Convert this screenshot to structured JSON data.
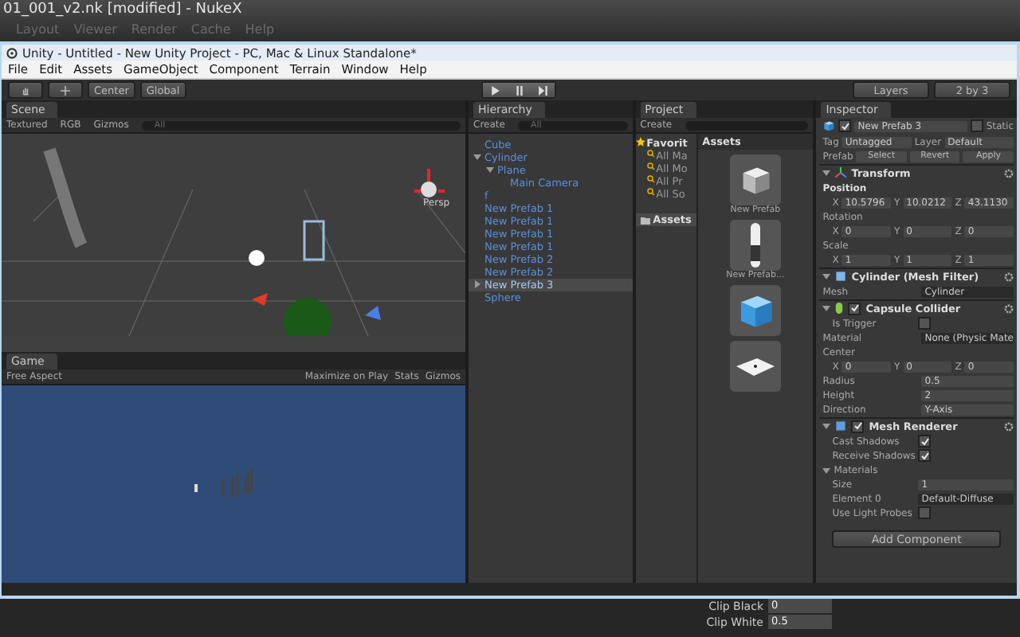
{
  "nuke": {
    "title": "01_001_v2.nk [modified] - NukeX",
    "menu": [
      "Layout",
      "Viewer",
      "Render",
      "Cache",
      "Help"
    ],
    "knobs": [
      {
        "label": "Clip Black",
        "value": "0"
      },
      {
        "label": "Clip White",
        "value": "0.5"
      }
    ]
  },
  "window": {
    "title": "Unity - Untitled - New Unity Project - PC, Mac & Linux Standalone*"
  },
  "menu": [
    "File",
    "Edit",
    "Assets",
    "GameObject",
    "Component",
    "Terrain",
    "Window",
    "Help"
  ],
  "toolbar": {
    "pivot": "Center",
    "space": "Global",
    "layers": "Layers",
    "layout": "2 by 3"
  },
  "scene": {
    "tab": "Scene",
    "render_mode": "Textured",
    "color_mode": "RGB",
    "gizmos": "Gizmos",
    "search_placeholder": "All",
    "view_label": "Persp"
  },
  "game": {
    "tab": "Game",
    "aspect": "Free Aspect",
    "buttons": [
      "Maximize on Play",
      "Stats",
      "Gizmos"
    ]
  },
  "hierarchy": {
    "tab": "Hierarchy",
    "create": "Create",
    "search_placeholder": "All",
    "items": [
      {
        "label": "Cube",
        "selected": false
      },
      {
        "label": "Cylinder",
        "selected": false,
        "expanded": true,
        "children": [
          {
            "label": "Plane",
            "selected": false,
            "expanded": true,
            "children": [
              {
                "label": "Main Camera",
                "selected": false
              }
            ]
          }
        ]
      },
      {
        "label": "f",
        "selected": false
      },
      {
        "label": "New Prefab 1",
        "selected": false
      },
      {
        "label": "New Prefab 1",
        "selected": false
      },
      {
        "label": "New Prefab 1",
        "selected": false
      },
      {
        "label": "New Prefab 1",
        "selected": false
      },
      {
        "label": "New Prefab 2",
        "selected": false
      },
      {
        "label": "New Prefab 2",
        "selected": false
      },
      {
        "label": "New Prefab 3",
        "selected": true,
        "expanded": false
      },
      {
        "label": "Sphere",
        "selected": false
      }
    ]
  },
  "project": {
    "tab": "Project",
    "create": "Create",
    "favorites": "Favorit",
    "favorite_items": [
      "All Ma",
      "All Mo",
      "All Pr",
      "All So"
    ],
    "folders": [
      {
        "label": "Assets",
        "selected": true
      }
    ],
    "breadcrumb": "Assets",
    "assets": [
      {
        "kind": "cube",
        "label": "New Prefab"
      },
      {
        "kind": "capsule",
        "label": "New Prefab..."
      },
      {
        "kind": "blue-cube"
      },
      {
        "kind": "plane"
      }
    ]
  },
  "inspector": {
    "tab": "Inspector",
    "object_name": "New Prefab 3",
    "active": true,
    "static_label": "Static",
    "static": false,
    "tag_label": "Tag",
    "tag": "Untagged",
    "layer_label": "Layer",
    "layer": "Default",
    "prefab_label": "Prefab",
    "prefab_buttons": [
      "Select",
      "Revert",
      "Apply"
    ],
    "components": [
      {
        "kind": "transform",
        "title": "Transform",
        "rows": [
          {
            "kind": "vector",
            "label": "Position",
            "bold": true,
            "values": [
              {
                "axis": "X",
                "value": "10.5796"
              },
              {
                "axis": "Y",
                "value": "10.0212"
              },
              {
                "axis": "Z",
                "value": "43.1130"
              }
            ]
          },
          {
            "kind": "vector",
            "label": "Rotation",
            "bold": false,
            "values": [
              {
                "axis": "X",
                "value": "0"
              },
              {
                "axis": "Y",
                "value": "0"
              },
              {
                "axis": "Z",
                "value": "0"
              }
            ]
          },
          {
            "kind": "vector",
            "label": "Scale",
            "bold": false,
            "values": [
              {
                "axis": "X",
                "value": "1"
              },
              {
                "axis": "Y",
                "value": "1"
              },
              {
                "axis": "Z",
                "value": "1"
              }
            ]
          }
        ]
      },
      {
        "kind": "mesh-filter",
        "title": "Cylinder (Mesh Filter)",
        "rows": [
          {
            "kind": "object",
            "label": "Mesh",
            "value": "Cylinder"
          }
        ]
      },
      {
        "kind": "collider",
        "title": "Capsule Collider",
        "enabled": true,
        "rows": [
          {
            "kind": "checkbox",
            "label": "Is Trigger",
            "checked": false
          },
          {
            "kind": "object",
            "label": "Material",
            "value": "None (Physic Mate"
          },
          {
            "kind": "vector",
            "label": "Center",
            "bold": false,
            "values": [
              {
                "axis": "X",
                "value": "0"
              },
              {
                "axis": "Y",
                "value": "0"
              },
              {
                "axis": "Z",
                "value": "0"
              }
            ]
          },
          {
            "kind": "text",
            "label": "Radius",
            "value": "0.5"
          },
          {
            "kind": "text",
            "label": "Height",
            "value": "2"
          },
          {
            "kind": "dropdown",
            "label": "Direction",
            "value": "Y-Axis"
          }
        ]
      },
      {
        "kind": "renderer",
        "title": "Mesh Renderer",
        "enabled": true,
        "rows": [
          {
            "kind": "checkbox",
            "label": "Cast Shadows",
            "checked": true
          },
          {
            "kind": "checkbox",
            "label": "Receive Shadows",
            "checked": true
          },
          {
            "kind": "group",
            "label": "Materials",
            "expanded": true
          },
          {
            "kind": "text",
            "label": "Size",
            "value": "1",
            "indent": true
          },
          {
            "kind": "object",
            "label": "Element 0",
            "value": "Default-Diffuse",
            "indent": true
          },
          {
            "kind": "checkbox",
            "label": "Use Light Probes",
            "checked": false
          }
        ]
      }
    ],
    "add_button": "Add Component"
  }
}
